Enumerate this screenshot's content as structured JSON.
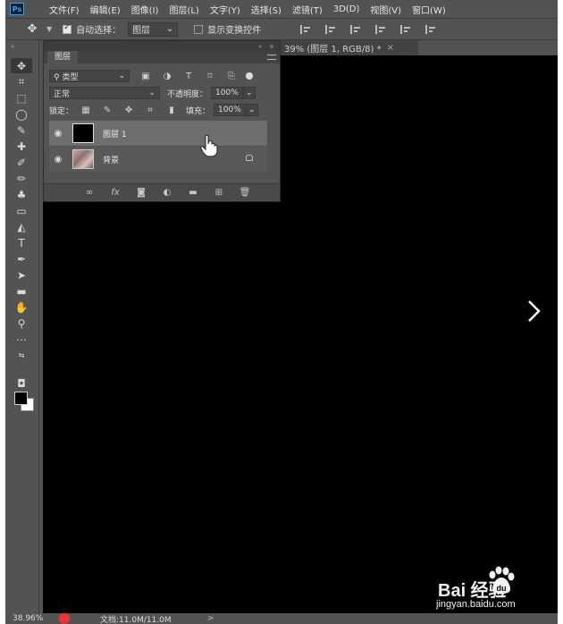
{
  "app": {
    "logo": "Ps"
  },
  "menu": [
    "文件(F)",
    "编辑(E)",
    "图像(I)",
    "图层(L)",
    "文字(Y)",
    "选择(S)",
    "滤镜(T)",
    "3D(D)",
    "视图(V)",
    "窗口(W)"
  ],
  "options_bar": {
    "auto_select_label": "自动选择：",
    "auto_select_target": "图层",
    "show_transform_label": "显示变换控件"
  },
  "document": {
    "tab_title": "39% (图层 1, RGB/8) *",
    "close_symbol": "×"
  },
  "layers_panel": {
    "tab_label": "图层",
    "filter_kind": "类型",
    "blend_mode": "正常",
    "opacity_label": "不透明度：",
    "opacity_value": "100%",
    "lock_label": "锁定：",
    "fill_label": "填充：",
    "fill_value": "100%",
    "layers": [
      {
        "name": "图层 1",
        "selected": true,
        "thumbnail": "black",
        "visible": true
      },
      {
        "name": "背景",
        "selected": false,
        "thumbnail": "photo",
        "visible": true,
        "locked": true
      }
    ]
  },
  "status_bar": {
    "zoom": "38.96%",
    "doc_info": "文档:11.0M/11.0M",
    "arrow": ">"
  },
  "watermark": {
    "text": "Bai  经验",
    "sub": "jingyan.baidu.com"
  },
  "colors": {
    "ui_bg": "#535353",
    "canvas": "#000000",
    "selected_layer": "#6e6e6e",
    "accent_logo": "#31a8ff",
    "record_dot": "#ee3333"
  },
  "icons": {
    "move_tool": "move-icon",
    "next": "chevron-right-icon"
  }
}
